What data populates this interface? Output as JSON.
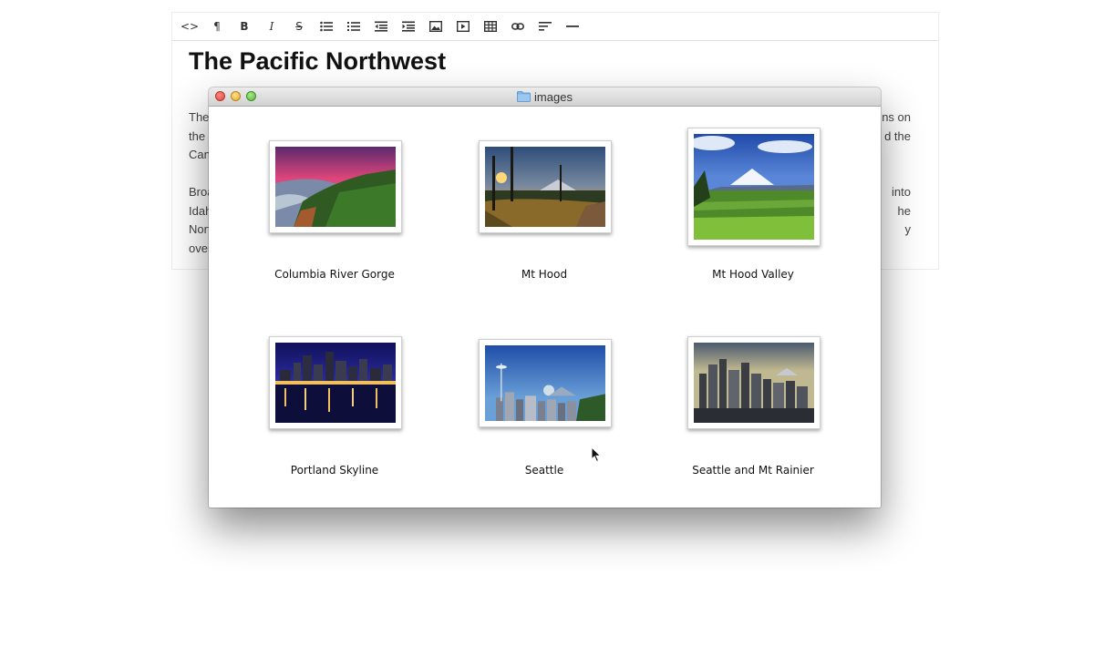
{
  "editor": {
    "toolbar": [
      {
        "name": "html-source",
        "glyph": "<>"
      },
      {
        "name": "paragraph-format",
        "glyph": "¶"
      },
      {
        "name": "bold",
        "glyph": "B"
      },
      {
        "name": "italic",
        "glyph": "I"
      },
      {
        "name": "strikethrough",
        "glyph": "S"
      },
      {
        "name": "unordered-list",
        "glyph": ""
      },
      {
        "name": "ordered-list",
        "glyph": ""
      },
      {
        "name": "outdent",
        "glyph": ""
      },
      {
        "name": "indent",
        "glyph": ""
      },
      {
        "name": "insert-image",
        "glyph": ""
      },
      {
        "name": "insert-video",
        "glyph": ""
      },
      {
        "name": "insert-table",
        "glyph": ""
      },
      {
        "name": "insert-link",
        "glyph": ""
      },
      {
        "name": "alignment",
        "glyph": ""
      },
      {
        "name": "horizontal-rule",
        "glyph": ""
      }
    ],
    "title": "The Pacific Northwest",
    "paragraph1_left": [
      "The",
      "the",
      "Can"
    ],
    "paragraph1_right": [
      "ns on",
      "d the",
      ""
    ],
    "paragraph2_left": [
      "Broa",
      "Idah",
      "Nort",
      "over"
    ],
    "paragraph2_right": [
      "into",
      "he",
      "y",
      ""
    ]
  },
  "finder": {
    "title": "images",
    "items": [
      {
        "label": "Columbia River Gorge"
      },
      {
        "label": "Mt Hood"
      },
      {
        "label": "Mt Hood Valley"
      },
      {
        "label": "Portland Skyline"
      },
      {
        "label": "Seattle"
      },
      {
        "label": "Seattle and Mt Rainier"
      }
    ]
  }
}
